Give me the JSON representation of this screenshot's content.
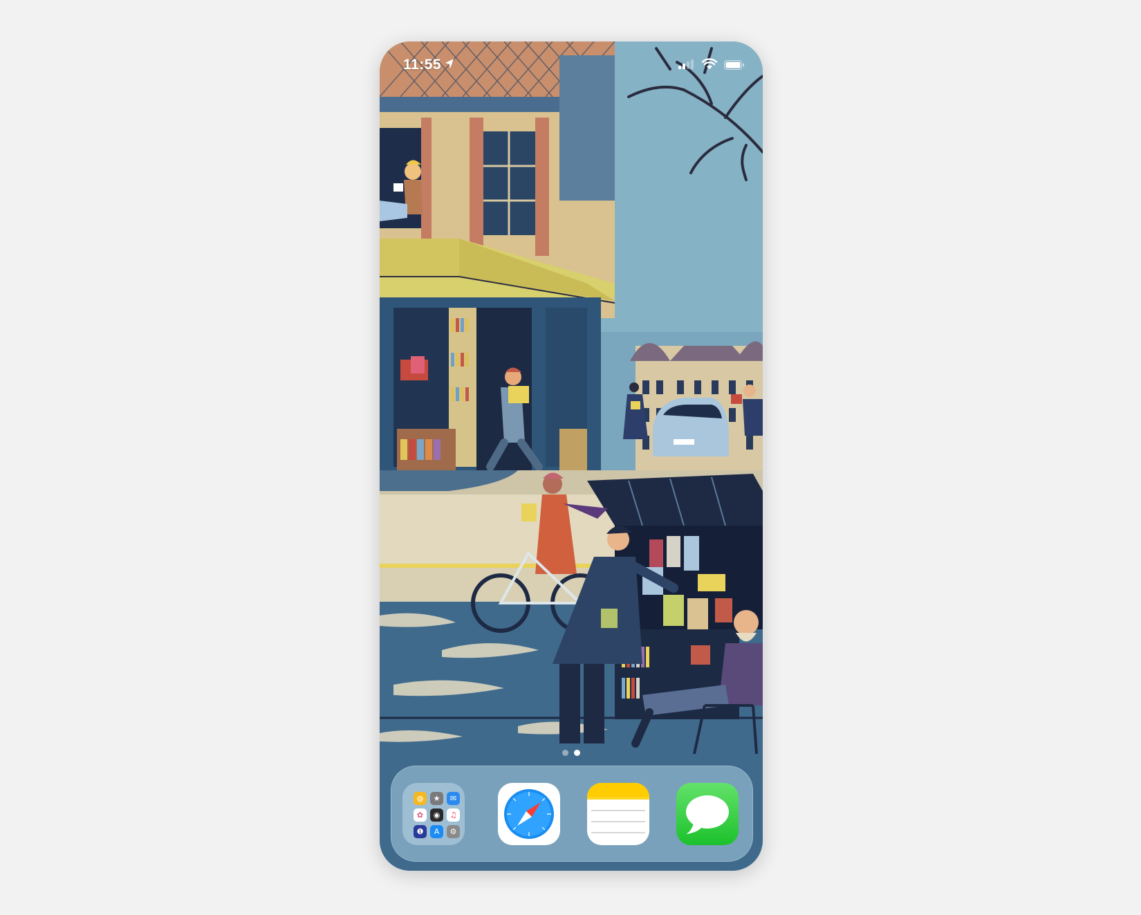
{
  "status_bar": {
    "time": "11:55",
    "location_icon": "location-arrow-icon",
    "signal_icon": "cellular-signal-icon",
    "wifi_icon": "wifi-icon",
    "battery_icon": "battery-icon"
  },
  "home": {
    "page_count": 2,
    "current_page": 2,
    "wallpaper": "illustrated-street-bookshop"
  },
  "dock": {
    "apps": [
      {
        "icon": "app-folder-icon",
        "contents": [
          "ScreenSearch",
          "iTunes Store",
          "Mail",
          "Photos",
          "Camera",
          "Music",
          "1Password",
          "App Store",
          "Settings"
        ]
      },
      {
        "icon": "safari-icon"
      },
      {
        "icon": "notes-icon"
      },
      {
        "icon": "messages-icon"
      }
    ]
  },
  "colors": {
    "background": "#f2f2f2",
    "messages_green": "#2bc840",
    "notes_yellow": "#ffd41f",
    "safari_blue": "#1a8cf0"
  }
}
